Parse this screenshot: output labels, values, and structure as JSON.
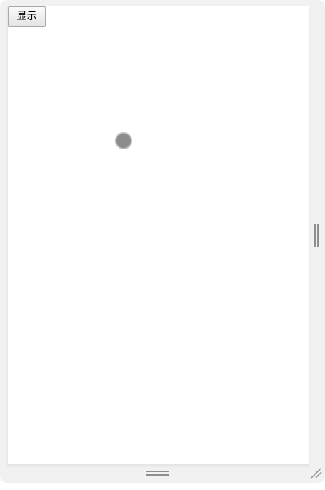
{
  "button": {
    "show_label": "显示"
  },
  "icons": {
    "loading": "loading-dot-icon",
    "resize_right": "vertical-grip-icon",
    "resize_bottom": "horizontal-grip-icon",
    "resize_corner": "resize-corner-icon"
  },
  "colors": {
    "frame": "#f1f1f1",
    "viewport": "#ffffff",
    "dot": "#8c8c8c",
    "handle": "#8e8e8e"
  }
}
